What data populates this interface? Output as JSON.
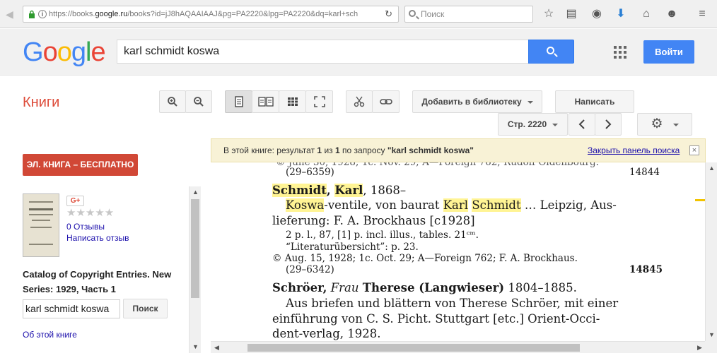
{
  "browser": {
    "url_prefix": "https://books.",
    "url_domain": "google.ru",
    "url_rest": "/books?id=jJ8hAQAAIAAJ&pg=PA2220&lpg=PA2220&dq=karl+sch",
    "search_placeholder": "Поиск"
  },
  "header": {
    "logo": [
      "G",
      "o",
      "o",
      "g",
      "l",
      "e"
    ],
    "logo_colors": [
      "#4285f4",
      "#ea4335",
      "#fbbc05",
      "#4285f4",
      "#34a853",
      "#ea4335"
    ],
    "query": "karl schmidt koswa",
    "login_label": "Войти"
  },
  "toolbar": {
    "section_title": "Книги",
    "add_to_library": "Добавить в библиотеку",
    "write_review": "Написать отзыв",
    "page_label": "Стр. 2220"
  },
  "notice": {
    "prefix": "В этой книге: результат ",
    "current": "1",
    "of": " из ",
    "total": "1",
    "mid": " по запросу ",
    "query": "\"karl schmidt koswa\"",
    "close_link": "Закрыть панель поиска",
    "close_x": "×"
  },
  "sidebar": {
    "ebook_button": "ЭЛ. КНИГА – БЕСПЛАТНО",
    "gplus": "G+",
    "stars": "★★★★★",
    "reviews": "0 Отзывы",
    "write_review": "Написать отзыв",
    "book_title": "Catalog of Copyright Entries. New Series: 1929, Часть 1",
    "search_value": "karl schmidt koswa",
    "search_button": "Поиск",
    "about_link": "Об этой книге"
  },
  "page_text": {
    "line1_a": "(29–6359)",
    "line1_b": "14844",
    "e1_name1": "Schmidt",
    "e1_comma": ", ",
    "e1_name2": "Karl",
    "e1_years": ", 1868–",
    "e1_koswa": "Koswa",
    "e1_t1": "-ventile, von baurat ",
    "e1_karl": "Karl",
    "e1_space": " ",
    "e1_schmidt": "Schmidt",
    "e1_t2": " …   Leipzig, Aus-",
    "e1_l3": "lieferung: F. A. Brockhaus ",
    "e1_l3b": "[",
    "e1_l3c": "c1928]",
    "e1_l4": "2 p. l., 87, [1] p. incl. illus., tables.  21ᶜᵐ.",
    "e1_l5": "“Literaturübersicht”: p. 23.",
    "e1_l6": "© Aug. 15, 1928; 1c. Oct. 29; A—Foreign 762; F. A. Brockhaus.",
    "e1_l7a": "(29–6342)",
    "e1_l7b": "14845",
    "e2_name": "Schröer,",
    "e2_frau": " Frau ",
    "e2_rest": "Therese (Langwieser)",
    "e2_years": " 1804–1885.",
    "e2_l2": "Aus briefen und blättern von Therese Schröer, mit einer",
    "e2_l3": "einführung von C. S. Picht.   Stuttgart [etc.] Orient-Occi-",
    "e2_l4": "dent-verlag, 1928."
  }
}
